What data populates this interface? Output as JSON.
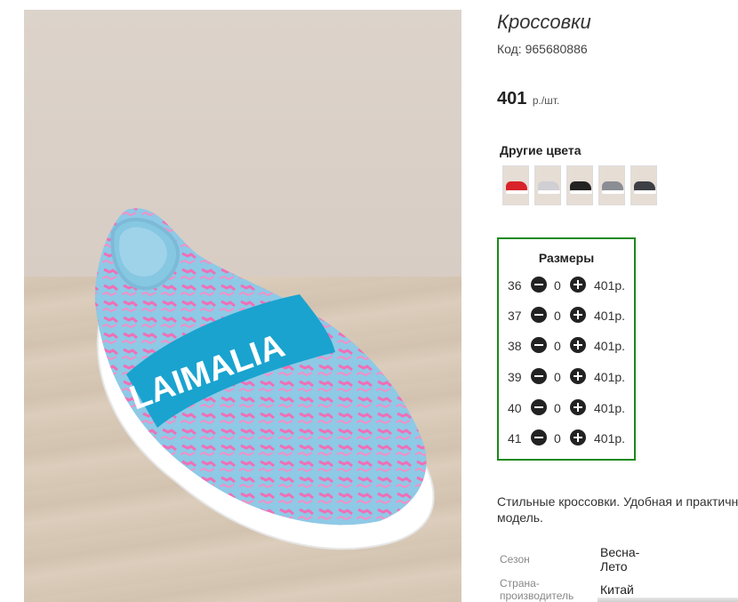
{
  "product": {
    "title": "Кроссовки",
    "code_label": "Код: 965680886",
    "price_value": "401",
    "price_unit": "р./шт."
  },
  "other_colors": {
    "title": "Другие цвета",
    "swatches": [
      {
        "name": "red",
        "color": "#d8232a"
      },
      {
        "name": "light-gray",
        "color": "#cfcfd4"
      },
      {
        "name": "black",
        "color": "#222222"
      },
      {
        "name": "gray-white",
        "color": "#8a8d93"
      },
      {
        "name": "dark-gray",
        "color": "#3d3f45"
      }
    ]
  },
  "sizes": {
    "title": "Размеры",
    "rows": [
      {
        "size": "36",
        "qty": "0",
        "price": "401р."
      },
      {
        "size": "37",
        "qty": "0",
        "price": "401р."
      },
      {
        "size": "38",
        "qty": "0",
        "price": "401р."
      },
      {
        "size": "39",
        "qty": "0",
        "price": "401р."
      },
      {
        "size": "40",
        "qty": "0",
        "price": "401р."
      },
      {
        "size": "41",
        "qty": "0",
        "price": "401р."
      }
    ]
  },
  "description": {
    "line1": "Стильные кроссовки. Удобная и практичная",
    "line2": "модель."
  },
  "properties": {
    "season_label": "Сезон",
    "season_value_1": "Весна-",
    "season_value_2": "Лето",
    "country_label_1": "Страна-",
    "country_label_2": "производитель",
    "country_value": "Китай"
  },
  "photo": {
    "strap_text": "LAIMALIA",
    "colors": {
      "knit": "#8ec9e6",
      "pattern": "#f06fb6",
      "strap": "#1aa3cf",
      "sole": "#ffffff"
    }
  }
}
